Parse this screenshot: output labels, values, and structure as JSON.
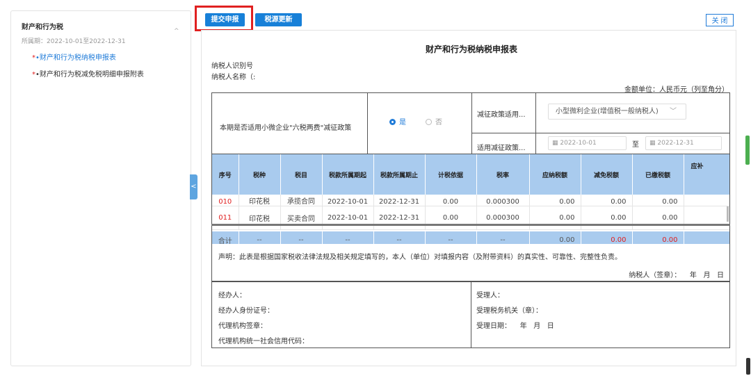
{
  "sidebar": {
    "title": "财产和行为税",
    "period": "所属期：2022-10-01至2022-12-31",
    "collapse_icon": "^",
    "items": [
      {
        "star": "*",
        "label": "•财产和行为税纳税申报表"
      },
      {
        "star": "*",
        "label": "•财产和行为税减免税明细申报附表"
      }
    ],
    "collapse_tab": "<"
  },
  "toolbar": {
    "submit_label": "提交申报",
    "update_label": "税源更新",
    "close_label": "关 闭"
  },
  "form": {
    "title": "财产和行为税纳税申报表",
    "taxpayer_id_label": "纳税人识别号",
    "taxpayer_name_label": "纳税人名称（:",
    "amount_unit": "金额单位：人民币元（列至角分）",
    "policy": {
      "question": "本期是否适用小微企业\"六税两费\"减征政策",
      "yes": "是",
      "no": "否",
      "selected": "是",
      "reduce_label": "减征政策适用...",
      "reduce_value": "小型微利企业(增值税一般纳税人)",
      "applicable_label": "适用减征政策...",
      "date_start": "2022-10-01",
      "date_to": "至",
      "date_end": "2022-12-31"
    },
    "table": {
      "headers": [
        "序号",
        "税种",
        "税目",
        "税款所属期起",
        "税款所属期止",
        "计税依据",
        "税率",
        "应纳税额",
        "减免税额",
        "已缴税额",
        "应补"
      ],
      "rows": [
        [
          "010",
          "印花税",
          "承揽合同",
          "2022-10-01",
          "2022-12-31",
          "0.00",
          "0.000300",
          "0.00",
          "0.00",
          "0.00",
          ""
        ],
        [
          "011",
          "印花税",
          "买卖合同",
          "2022-10-01",
          "2022-12-31",
          "0.00",
          "0.000300",
          "0.00",
          "0.00",
          "0.00",
          ""
        ]
      ],
      "total": [
        "合计",
        "--",
        "--",
        "--",
        "--",
        "--",
        "--",
        "0.00",
        "0.00",
        "0.00",
        ""
      ]
    },
    "declaration": "声明：此表是根据国家税收法律法规及相关规定填写的，本人（单位）对填报内容（及附带资料）的真实性、可靠性、完整性负责。",
    "sign": "纳税人（签章）：    年   月   日",
    "info_left": [
      "经办人：",
      "经办人身份证号：",
      "代理机构签章：",
      "代理机构统一社会信用代码："
    ],
    "info_right": [
      "受理人：",
      "受理税务机关（章）：",
      "受理日期：    年   月   日"
    ]
  },
  "colors": {
    "accent": "#1780d8",
    "highlight": "#e02020",
    "table_header": "#a9cbee"
  }
}
